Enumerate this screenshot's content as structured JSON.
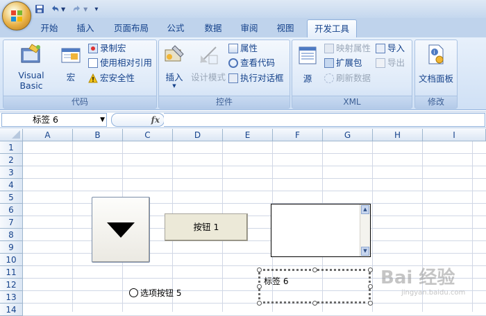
{
  "quick_access": {
    "save_icon": "save-icon",
    "undo_icon": "undo-icon",
    "redo_icon": "redo-icon",
    "customize_icon": "customize-qat-icon"
  },
  "tabs": [
    {
      "label": "开始"
    },
    {
      "label": "插入"
    },
    {
      "label": "页面布局"
    },
    {
      "label": "公式"
    },
    {
      "label": "数据"
    },
    {
      "label": "审阅"
    },
    {
      "label": "视图"
    },
    {
      "label": "开发工具",
      "active": true
    }
  ],
  "ribbon": {
    "code": {
      "label": "代码",
      "visual_basic": "Visual Basic",
      "macros": "宏",
      "record_macro": "录制宏",
      "relative_ref": "使用相对引用",
      "macro_security": "宏安全性"
    },
    "controls": {
      "label": "控件",
      "insert": "插入",
      "design_mode": "设计模式",
      "properties": "属性",
      "view_code": "查看代码",
      "run_dialog": "执行对话框"
    },
    "xml": {
      "label": "XML",
      "source": "源",
      "map_properties": "映射属性",
      "expansion_packs": "扩展包",
      "refresh_data": "刷新数据",
      "import": "导入",
      "export": "导出"
    },
    "modify": {
      "label": "修改",
      "document_panel": "文档面板"
    }
  },
  "formula_bar": {
    "name_box": "标签 6",
    "fx": "fx",
    "value": ""
  },
  "columns": [
    "A",
    "B",
    "C",
    "D",
    "E",
    "F",
    "G",
    "H",
    "I"
  ],
  "rows": [
    "1",
    "2",
    "3",
    "4",
    "5",
    "6",
    "7",
    "8",
    "9",
    "10",
    "11",
    "12",
    "13",
    "14"
  ],
  "form_controls": {
    "button": "按钮 1",
    "option_button": "选项按钮 5",
    "label": "标签 6"
  },
  "watermark": {
    "text": "Bai 经验",
    "subtext": "jingyan.baidu.com"
  },
  "colors": {
    "ribbon_bg": "#dbe8f7",
    "tab_text": "#15428b",
    "grid_line": "#d0d7e5"
  }
}
